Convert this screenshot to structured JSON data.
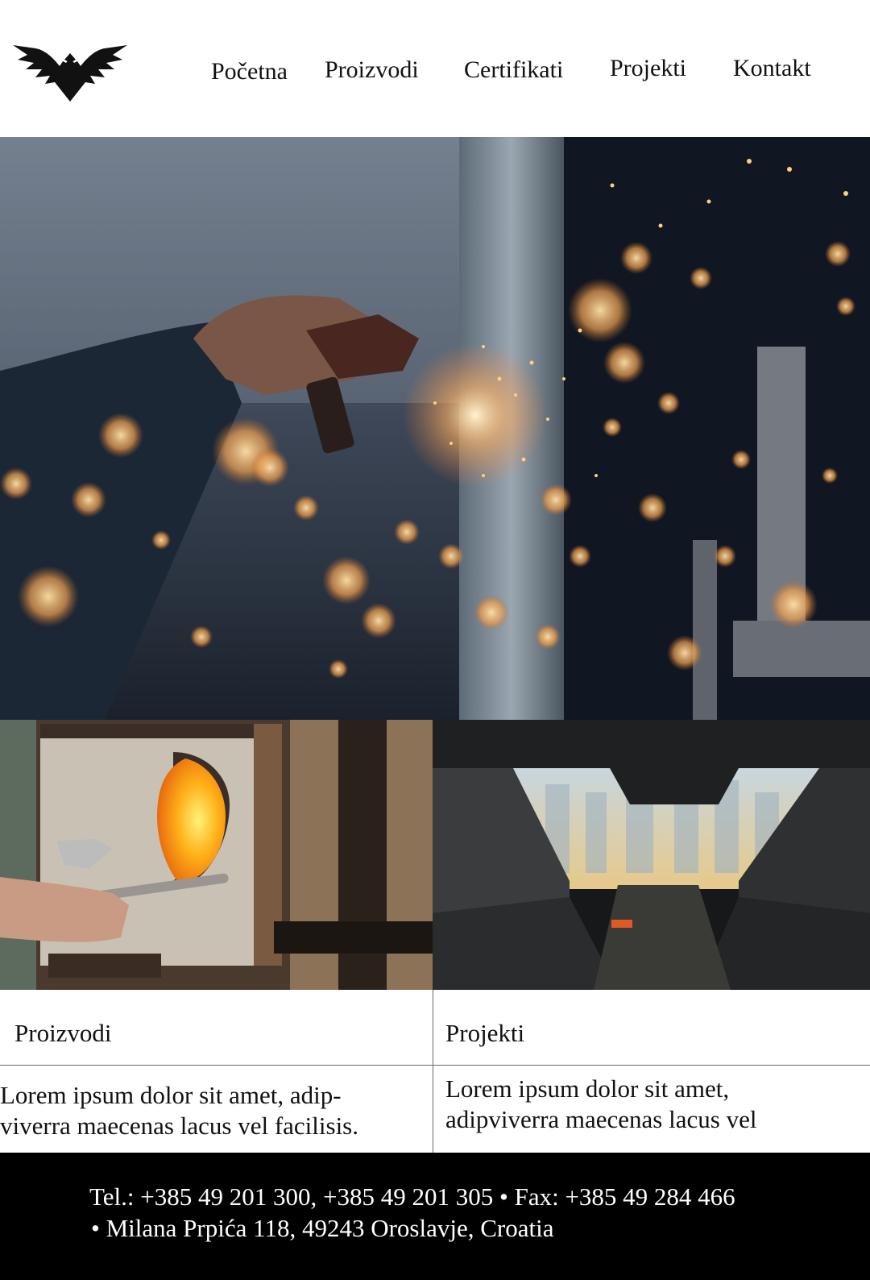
{
  "nav": {
    "items": [
      {
        "label": "Početna"
      },
      {
        "label": "Proizvodi"
      },
      {
        "label": "Certifikati"
      },
      {
        "label": "Projekti"
      },
      {
        "label": "Kontakt"
      }
    ]
  },
  "logo": {
    "icon": "eagle-logo-icon",
    "color": "#111111"
  },
  "hero": {
    "image": "welding-sparks-photo"
  },
  "gallery": {
    "left_image": "glass-furnace-photo",
    "right_image": "steel-beam-photo"
  },
  "cards": {
    "products": {
      "title": "Proizvodi",
      "line1": "Lorem ipsum dolor sit amet, adip-",
      "line2": "viverra maecenas  lacus vel facilisis."
    },
    "projects": {
      "title": "Projekti",
      "line1": "Lorem ipsum dolor sit amet,",
      "line2": "adipviverra maecenas  lacus vel"
    }
  },
  "footer": {
    "line1": "Tel.: +385 49 201 300, +385 49 201 305 • Fax: +385 49 284 466",
    "line2": "• Milana Prpića 118, 49243 Oroslavje, Croatia",
    "background": "#000000"
  }
}
